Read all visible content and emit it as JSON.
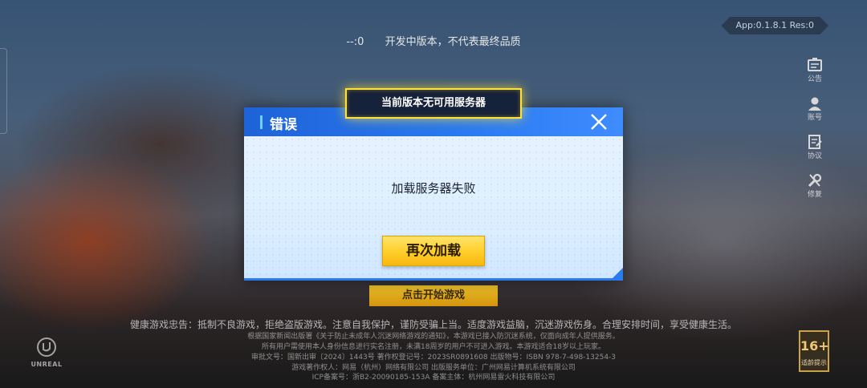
{
  "top_notice": {
    "code": "--:0",
    "text": "开发中版本，不代表最终品质"
  },
  "version": "App:0.1.8.1 Res:0",
  "side_menu": [
    {
      "label": "公告",
      "icon": "announcement-icon"
    },
    {
      "label": "账号",
      "icon": "account-icon"
    },
    {
      "label": "协议",
      "icon": "agreement-icon"
    },
    {
      "label": "修复",
      "icon": "repair-icon"
    }
  ],
  "dialog": {
    "banner": "当前版本无可用服务器",
    "title": "错误",
    "message": "加载服务器失败",
    "reload_label": "再次加载"
  },
  "start_game": "点击开始游戏",
  "footer": {
    "health_notice": "健康游戏忠告：抵制不良游戏，拒绝盗版游戏。注意自我保护，谨防受骗上当。适度游戏益脑，沉迷游戏伤身。合理安排时间，享受健康生活。",
    "line1": "根据国家新闻出版署《关于防止未成年人沉迷网络游戏的通知》，本游戏已接入防沉迷系统，仅面向成年人提供服务。",
    "line2": "所有用户需使用本人身份信息进行实名注册，未满18周岁的用户不可进入游戏。本游戏适合18岁以上玩家。",
    "line3": "审批文号：国新出审〔2024〕1443号   著作权登记号：2023SR0891608   出版物号：ISBN 978-7-498-13254-3",
    "line4": "游戏著作权人：网易（杭州）网络有限公司   出版服务单位：广州网易计算机系统有限公司",
    "line5": "ICP备案号：浙B2-20090185-153A   备案主体：杭州网易雷火科技有限公司"
  },
  "engine_logo": "UNREAL",
  "age_rating": {
    "number": "16+",
    "label": "适龄提示"
  }
}
